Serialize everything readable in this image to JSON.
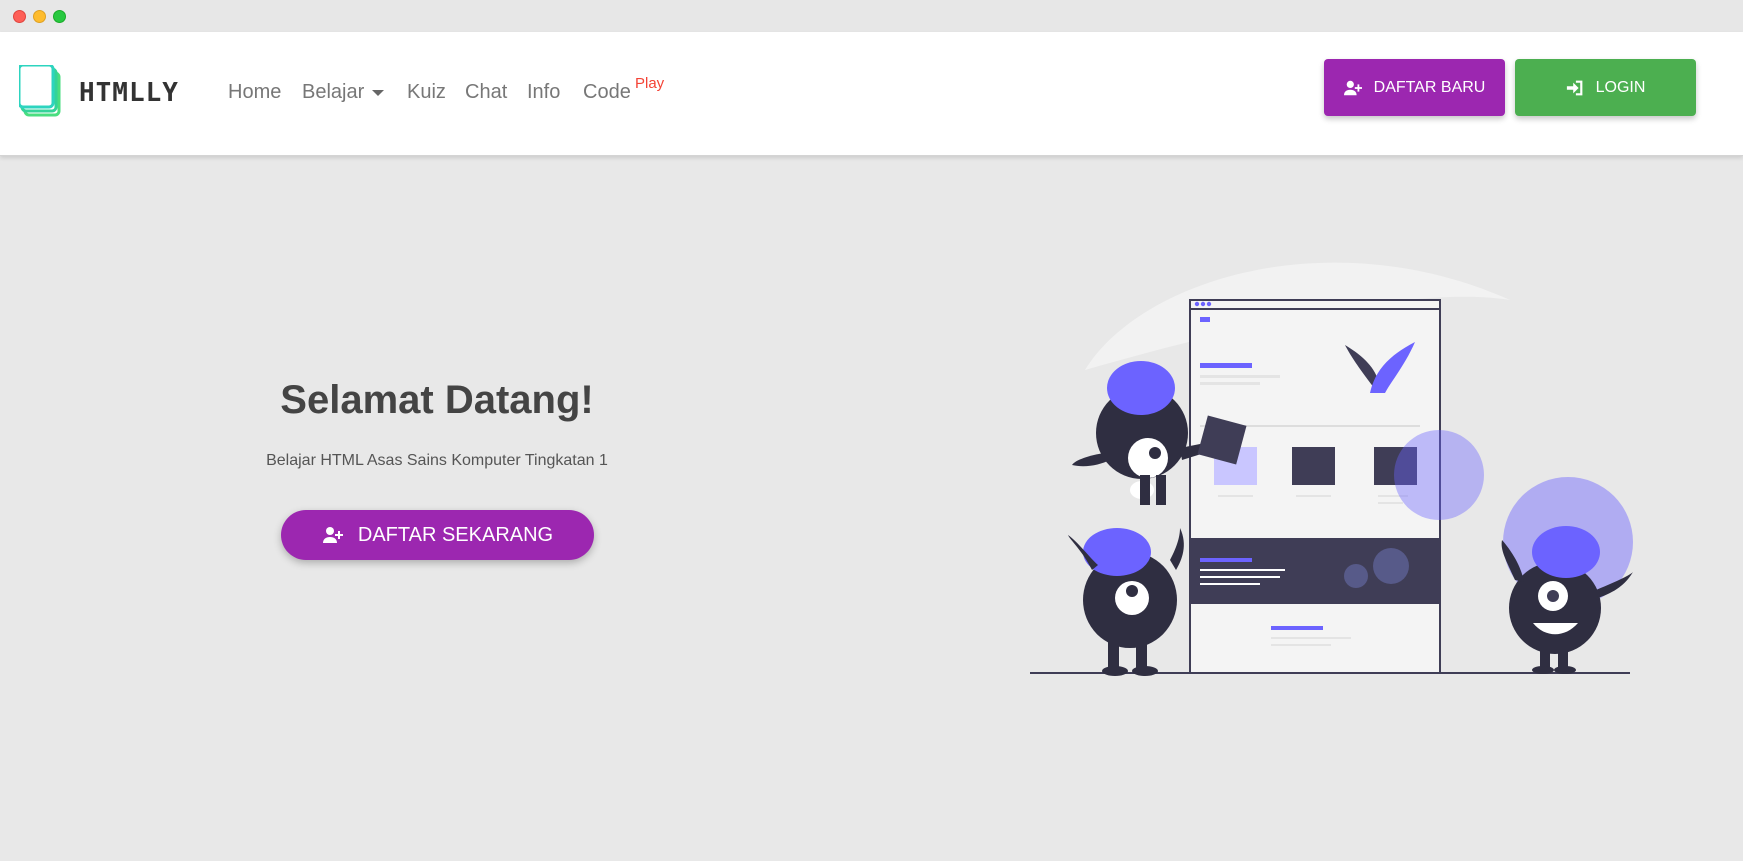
{
  "app": {
    "brand": "HTMLLY"
  },
  "nav": {
    "home": "Home",
    "belajar": "Belajar",
    "kuiz": "Kuiz",
    "chat": "Chat",
    "info": "Info",
    "code": "Code",
    "code_badge": "Play"
  },
  "actions": {
    "daftar_baru": "DAFTAR BARU",
    "login": "LOGIN"
  },
  "hero": {
    "title": "Selamat Datang!",
    "subtitle": "Belajar HTML Asas Sains Komputer Tingkatan 1",
    "cta": "DAFTAR SEKARANG"
  },
  "colors": {
    "primary": "#9c27b0",
    "success": "#4caf50",
    "accent": "#6c63ff",
    "badge": "#f44336"
  },
  "icons": {
    "daftar": "user-plus-icon",
    "login": "sign-in-icon",
    "cta": "user-plus-icon"
  }
}
